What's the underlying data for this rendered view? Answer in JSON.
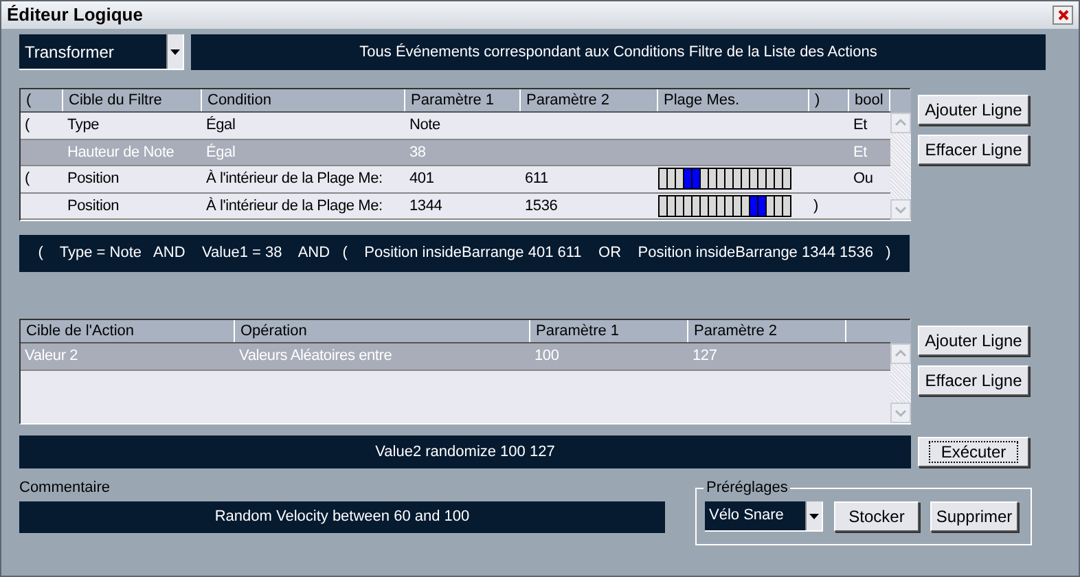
{
  "window": {
    "title": "Éditeur Logique"
  },
  "mode_dropdown": {
    "value": "Transformer"
  },
  "description": "Tous Événements correspondant aux Conditions Filtre de la Liste des Actions",
  "filter_table": {
    "columns": [
      "(",
      "Cible du Filtre",
      "Condition",
      "Paramètre 1",
      "Paramètre 2",
      "Plage Mes.",
      ")",
      "bool"
    ],
    "rows": [
      {
        "selected": false,
        "open_paren": "(",
        "target": "Type",
        "condition": "Égal",
        "param1": "Note",
        "bool": "Et"
      },
      {
        "selected": true,
        "target": "Hauteur de Note",
        "condition": "Égal",
        "param1": "38",
        "bool": "Et"
      },
      {
        "selected": false,
        "open_paren": "(",
        "target": "Position",
        "condition": "À l'intérieur de la Plage Me:",
        "param1": "401",
        "param2": "611",
        "range": [
          false,
          false,
          false,
          true,
          true,
          false,
          false,
          false,
          false,
          false,
          false,
          false,
          false,
          false,
          false,
          false
        ],
        "bool": "Ou"
      },
      {
        "selected": false,
        "target": "Position",
        "condition": "À l'intérieur de la Plage Me:",
        "param1": "1344",
        "param2": "1536",
        "range": [
          false,
          false,
          false,
          false,
          false,
          false,
          false,
          false,
          false,
          false,
          false,
          true,
          true,
          false,
          false,
          false
        ],
        "close_paren": ")"
      }
    ]
  },
  "filter_buttons": [
    "Ajouter Ligne",
    "Effacer Ligne"
  ],
  "expression": "(    Type = Note   AND    Value1 = 38    AND   (    Position insideBarrange 401 611    OR    Position insideBarrange 1344 1536   )",
  "action_table": {
    "columns": [
      "Cible de l'Action",
      "Opération",
      "Paramètre 1",
      "Paramètre 2"
    ],
    "rows": [
      {
        "selected": true,
        "target": "Valeur 2",
        "operation": "Valeurs Aléatoires entre",
        "param1": "100",
        "param2": "127"
      }
    ]
  },
  "action_buttons": [
    "Ajouter Ligne",
    "Effacer Ligne"
  ],
  "result": "Value2 randomize 100 127",
  "execute_button": {
    "label": "Exécuter",
    "focused": true
  },
  "comment_label": "Commentaire",
  "comment": "Random Velocity between 60 and 100",
  "presets": {
    "title": "Préréglages",
    "value": "Vélo Snare",
    "buttons": [
      "Stocker",
      "Supprimer"
    ]
  }
}
